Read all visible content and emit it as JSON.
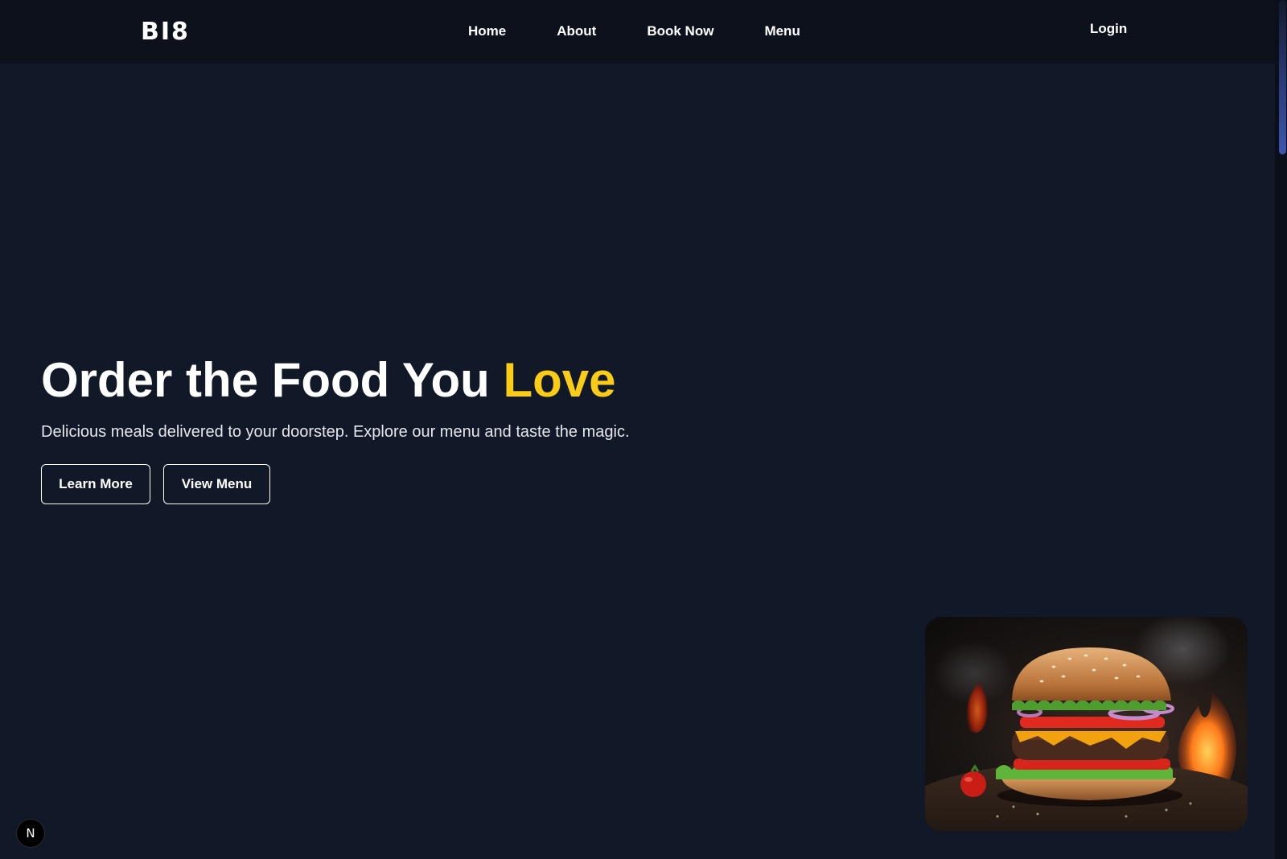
{
  "header": {
    "logo": "BI8",
    "nav": [
      "Home",
      "About",
      "Book Now",
      "Menu"
    ],
    "login": "Login"
  },
  "hero": {
    "title_main": "Order the Food You ",
    "title_accent": "Love",
    "subtitle": "Delicious meals delivered to your doorstep. Explore our menu and taste the magic.",
    "buttons": {
      "learn_more": "Learn More",
      "view_menu": "View Menu"
    }
  },
  "badge": {
    "label": "N",
    "icon": "nextjs-icon"
  },
  "colors": {
    "background": "#111827",
    "navbar": "#0c111c",
    "accent": "#facc15",
    "text": "#ffffff"
  }
}
